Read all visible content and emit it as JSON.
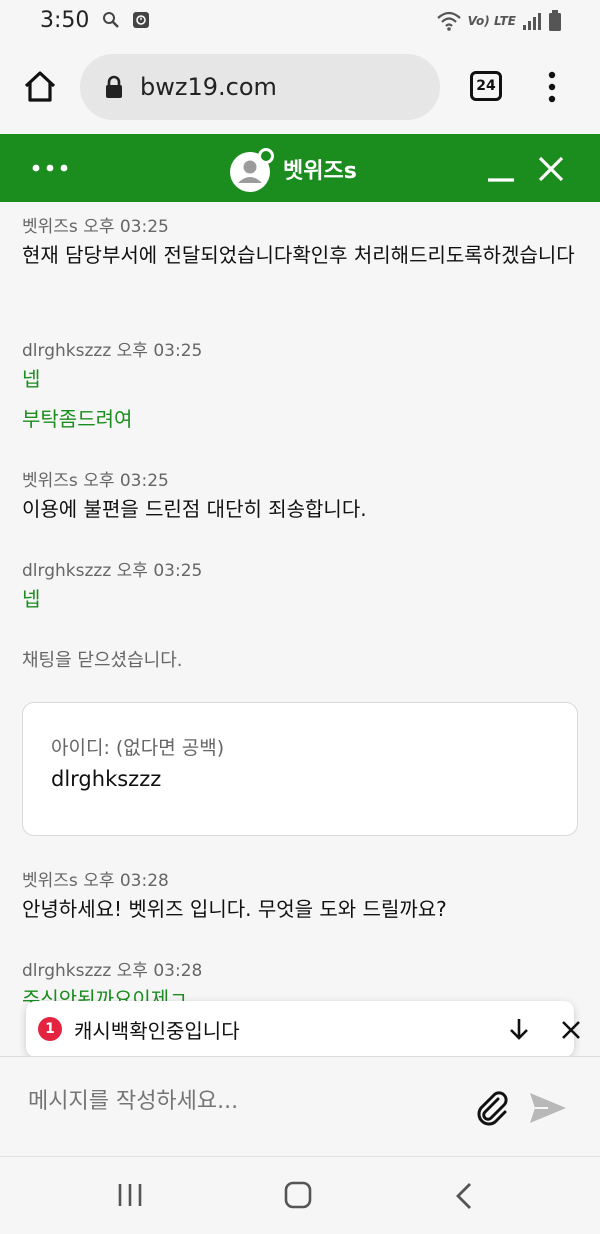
{
  "status_bar": {
    "time": "3:50",
    "network": "Vo) LTE",
    "icons": [
      "search-icon",
      "app-notification-icon",
      "wifi-icon",
      "signal-icon",
      "battery-icon"
    ]
  },
  "browser": {
    "url": "bwz19.com",
    "tab_count": "24",
    "icons": [
      "home-icon",
      "lock-icon",
      "more-vert-icon"
    ]
  },
  "chat_header": {
    "title": "벳위즈s",
    "color": "#1b8d1f"
  },
  "messages": [
    {
      "sender": "벳위즈s",
      "time": "오후 03:25",
      "texts": [
        "현재 담당부서에 전달되었습니다확인후 처리해드리도록하겠습니다"
      ],
      "style": "agent"
    },
    {
      "sender": "dlrghkszzz",
      "time": "오후 03:25",
      "texts": [
        "넵",
        "부탁좀드려여"
      ],
      "style": "user"
    },
    {
      "sender": "벳위즈s",
      "time": "오후 03:25",
      "texts": [
        "이용에 불편을 드린점 대단히 죄송합니다."
      ],
      "style": "agent"
    },
    {
      "sender": "dlrghkszzz",
      "time": "오후 03:25",
      "texts": [
        "넵"
      ],
      "style": "user"
    },
    {
      "sender": "벳위즈s",
      "time": "오후 03:28",
      "texts": [
        "안녕하세요! 벳위즈 입니다. 무엇을 도와 드릴까요?"
      ],
      "style": "agent"
    },
    {
      "sender": "dlrghkszzz",
      "time": "오후 03:28",
      "texts": [
        "주신안된까요이제ㄱ"
      ],
      "style": "user"
    }
  ],
  "system_message": "채팅을 닫으셨습니다.",
  "form_card": {
    "label": "아이디: (없다면 공백)",
    "value": "dlrghkszzz"
  },
  "notification": {
    "count": "1",
    "text": "캐시백확인중입니다"
  },
  "composer": {
    "placeholder": "메시지를 작성하세요..."
  },
  "nav": {
    "icons": [
      "recents-icon",
      "home-nav-icon",
      "back-icon"
    ]
  }
}
